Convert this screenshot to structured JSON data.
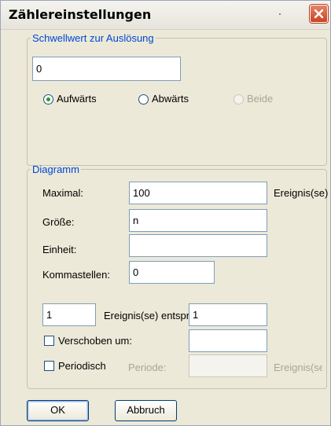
{
  "window": {
    "title": "Zählereinstellungen"
  },
  "threshold": {
    "legend": "Schwellwert zur Auslösung",
    "value": "0",
    "radios": [
      {
        "label": "Aufwärts",
        "checked": true,
        "enabled": true
      },
      {
        "label": "Abwärts",
        "checked": false,
        "enabled": true
      },
      {
        "label": "Beide",
        "checked": false,
        "enabled": false
      }
    ]
  },
  "diagram": {
    "legend": "Diagramm",
    "max_label": "Maximal:",
    "max_value": "100",
    "max_unit": "Ereignis(se)",
    "size_label": "Größe:",
    "size_value": "n",
    "unit_label": "Einheit:",
    "unit_value": "",
    "decimals_label": "Kommastellen:",
    "decimals_value": "0",
    "ratio_left_value": "1",
    "ratio_label": "Ereignis(se) entsprechen",
    "ratio_right_value": "1",
    "shifted_label": "Verschoben um:",
    "shifted_value": "",
    "periodic_label": "Periodisch",
    "period_label": "Periode:",
    "period_value": "",
    "period_unit": "Ereignis(se)"
  },
  "buttons": {
    "ok": "OK",
    "cancel": "Abbruch"
  }
}
